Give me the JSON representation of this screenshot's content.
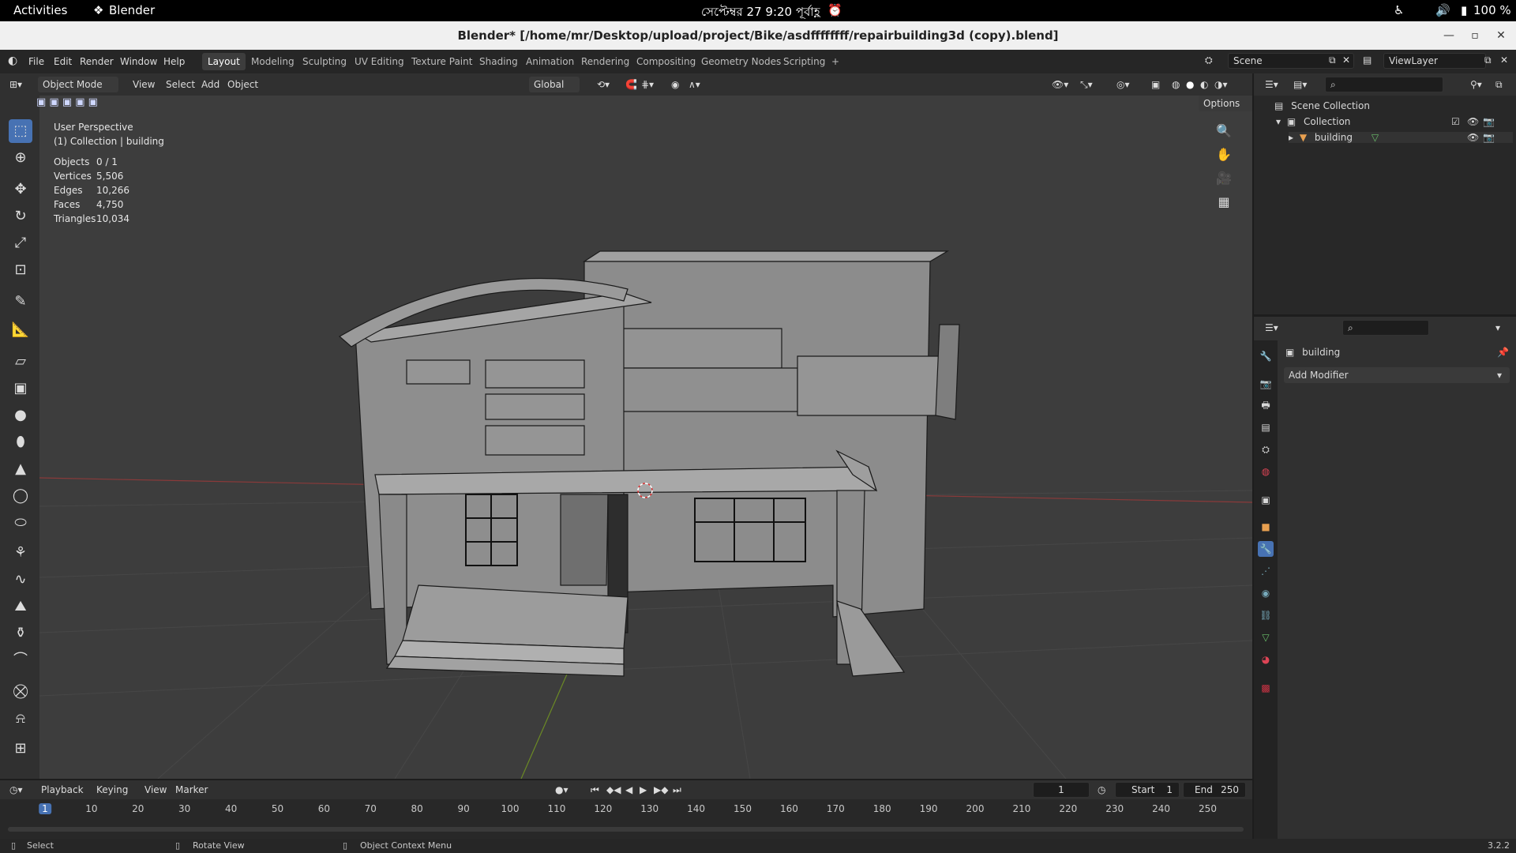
{
  "gnome": {
    "activities": "Activities",
    "app_name": "Blender",
    "clock": "সেপ্টেম্বর 27  9:20 পূর্বাহ্ণ",
    "battery": "100 %"
  },
  "window": {
    "title": "Blender* [/home/mr/Desktop/upload/project/Bike/asdffffffff/repairbuilding3d (copy).blend]"
  },
  "menu": {
    "items": [
      "File",
      "Edit",
      "Render",
      "Window",
      "Help"
    ],
    "workspaces": [
      "Layout",
      "Modeling",
      "Sculpting",
      "UV Editing",
      "Texture Paint",
      "Shading",
      "Animation",
      "Rendering",
      "Compositing",
      "Geometry Nodes",
      "Scripting"
    ],
    "active_workspace": "Layout",
    "add_workspace": "+",
    "scene": "Scene",
    "view_layer": "ViewLayer"
  },
  "viewport_header": {
    "mode": "Object Mode",
    "menus": [
      "View",
      "Select",
      "Add",
      "Object"
    ],
    "transform_orientation": "Global",
    "options": "Options"
  },
  "viewport": {
    "perspective": "User Perspective",
    "collection_info": "(1) Collection | building",
    "stats": [
      {
        "label": "Objects",
        "value": "0 / 1"
      },
      {
        "label": "Vertices",
        "value": "5,506"
      },
      {
        "label": "Edges",
        "value": "10,266"
      },
      {
        "label": "Faces",
        "value": "4,750"
      },
      {
        "label": "Triangles",
        "value": "10,034"
      }
    ]
  },
  "outliner": {
    "scene_collection": "Scene Collection",
    "collection": "Collection",
    "object": "building"
  },
  "properties": {
    "object_name": "building",
    "add_modifier": "Add Modifier"
  },
  "timeline": {
    "menus": [
      "Playback",
      "Keying",
      "View",
      "Marker"
    ],
    "current_frame": "1",
    "start_label": "Start",
    "start": "1",
    "end_label": "End",
    "end": "250",
    "ticks": [
      "1",
      "10",
      "20",
      "30",
      "40",
      "50",
      "60",
      "70",
      "80",
      "90",
      "100",
      "110",
      "120",
      "130",
      "140",
      "150",
      "160",
      "170",
      "180",
      "190",
      "200",
      "210",
      "220",
      "230",
      "240",
      "250"
    ]
  },
  "statusbar": {
    "select": "Select",
    "rotate": "Rotate View",
    "context": "Object Context Menu",
    "version": "3.2.2"
  }
}
